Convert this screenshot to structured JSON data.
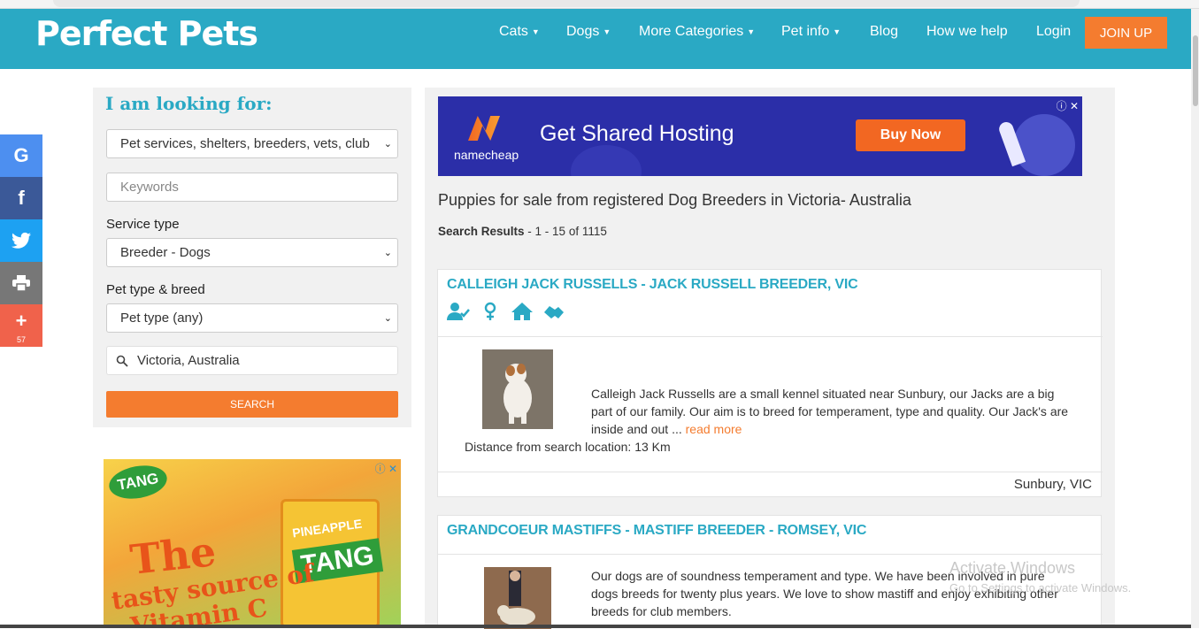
{
  "header": {
    "logo": "Perfect Pets",
    "nav": [
      {
        "label": "Cats",
        "caret": "▼"
      },
      {
        "label": "Dogs",
        "caret": "▼"
      },
      {
        "label": "More Categories",
        "caret": "▼"
      },
      {
        "label": "Pet info",
        "caret": "▼"
      },
      {
        "label": "Blog",
        "caret": ""
      },
      {
        "label": "How we help",
        "caret": ""
      },
      {
        "label": "Login",
        "caret": ""
      }
    ],
    "join": "JOIN UP"
  },
  "social": [
    {
      "name": "google",
      "glyph": "G",
      "color": "#4d8ff0",
      "count": ""
    },
    {
      "name": "facebook",
      "glyph": "f",
      "color": "#3b5998",
      "count": ""
    },
    {
      "name": "twitter",
      "glyph": "t",
      "color": "#1da1f2",
      "count": ""
    },
    {
      "name": "print",
      "glyph": "⎙",
      "color": "#777777",
      "count": ""
    },
    {
      "name": "more",
      "glyph": "+",
      "color": "#f0624b",
      "count": "57"
    }
  ],
  "sidebar": {
    "title": "I am looking for:",
    "category_select": "Pet services, shelters, breeders, vets, club",
    "keywords_placeholder": "Keywords",
    "service_type_label": "Service type",
    "service_type_value": "Breeder - Dogs",
    "pet_type_label": "Pet type & breed",
    "pet_type_value": "Pet type (any)",
    "location_value": "Victoria,  Australia",
    "search_button": "SEARCH"
  },
  "ad_top": {
    "brand": "namecheap",
    "headline": "Get Shared Hosting",
    "cta": "Buy Now"
  },
  "ad_side": {
    "brand": "TANG",
    "flavor": "PINEAPPLE",
    "pack_brand": "TANG",
    "line1": "The",
    "line2": "tasty source of",
    "line3": "Vitamin C"
  },
  "main": {
    "heading": "Puppies for sale from registered Dog Breeders in Victoria- Australia",
    "results_label": "Search Results",
    "results_range": " - 1 - 15 of 1115"
  },
  "listings": [
    {
      "title": "CALLEIGH JACK RUSSELLS - JACK RUSSELL BREEDER, VIC",
      "description": "Calleigh Jack Russells are a small kennel situated near Sunbury, our Jacks are a big part of our family. Our aim is to breed for temperament, type and quality. Our Jack's are inside and out ... ",
      "read_more": "read more",
      "distance": "Distance from search location: 13 Km",
      "location": "Sunbury, VIC"
    },
    {
      "title": "GRANDCOEUR MASTIFFS - MASTIFF BREEDER - ROMSEY, VIC",
      "description": "Our dogs are of soundness temperament and type. We have been involved in pure dogs breeds for twenty plus years. We love to show mastiff and enjoy exhibiting other breeds for club members."
    }
  ],
  "watermark": {
    "line1": "Activate Windows",
    "line2": "Go to Settings to activate Windows."
  },
  "colors": {
    "brand_teal": "#2aa9c4",
    "accent_orange": "#f47c2f"
  }
}
